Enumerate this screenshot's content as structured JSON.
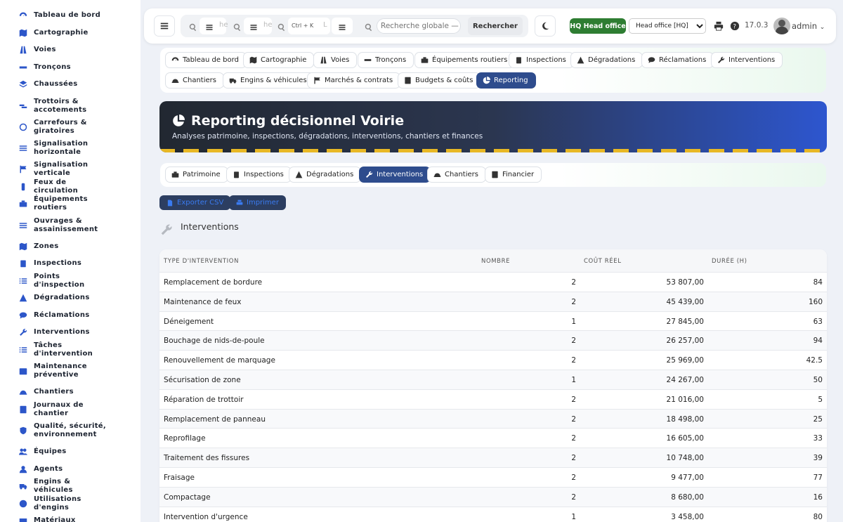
{
  "sidebar": {
    "items": [
      {
        "label": "Tableau de bord",
        "icon": "dashboard-icon"
      },
      {
        "label": "Cartographie",
        "icon": "map-icon"
      },
      {
        "label": "Voies",
        "icon": "road-icon"
      },
      {
        "label": "Tronçons",
        "icon": "segment-icon"
      },
      {
        "label": "Chaussées",
        "icon": "layers-icon"
      },
      {
        "label": "Trottoirs & accotements",
        "icon": "sidewalk-icon"
      },
      {
        "label": "Carrefours & giratoires",
        "icon": "roundabout-icon"
      },
      {
        "label": "Signalisation horizontale",
        "icon": "marking-icon"
      },
      {
        "label": "Signalisation verticale",
        "icon": "sign-icon"
      },
      {
        "label": "Feux de circulation",
        "icon": "traffic-light-icon"
      },
      {
        "label": "Équipements routiers",
        "icon": "equipment-icon"
      },
      {
        "label": "Ouvrages & assainissement",
        "icon": "water-icon"
      },
      {
        "label": "Zones",
        "icon": "zones-icon"
      },
      {
        "label": "Inspections",
        "icon": "clipboard-icon"
      },
      {
        "label": "Points d'inspection",
        "icon": "list-icon"
      },
      {
        "label": "Dégradations",
        "icon": "warning-icon"
      },
      {
        "label": "Réclamations",
        "icon": "comment-icon"
      },
      {
        "label": "Interventions",
        "icon": "wrench-icon"
      },
      {
        "label": "Tâches d'intervention",
        "icon": "tasks-icon"
      },
      {
        "label": "Maintenance préventive",
        "icon": "calendar-check-icon"
      },
      {
        "label": "Chantiers",
        "icon": "hardhat-icon"
      },
      {
        "label": "Journaux de chantier",
        "icon": "book-icon"
      },
      {
        "label": "Qualité, sécurité, environnement",
        "icon": "shield-icon"
      },
      {
        "label": "Équipes",
        "icon": "users-icon"
      },
      {
        "label": "Agents",
        "icon": "user-icon"
      },
      {
        "label": "Engins & véhicules",
        "icon": "truck-icon"
      },
      {
        "label": "Utilisations d'engins",
        "icon": "clock-icon"
      },
      {
        "label": "Matériaux",
        "icon": "box-icon"
      }
    ]
  },
  "topbar": {
    "search_placeholder": "Recherche globale — c",
    "search_button": "Rechercher",
    "mini_placeholder_1": "he",
    "mini_placeholder_2": "he",
    "mini_placeholder_3": "L",
    "shortcut": "Ctrl + K",
    "hq_badge": "HQ  Head office",
    "office_select": "Head office [HQ]",
    "version": "17.0.3",
    "username": "admin"
  },
  "nav": {
    "row1": [
      "Tableau de bord",
      "Cartographie",
      "Voies",
      "Tronçons",
      "Équipements routiers",
      "Inspections",
      "Dégradations",
      "Réclamations",
      "Interventions"
    ],
    "row2": [
      "Chantiers",
      "Engins & véhicules",
      "Marchés & contrats",
      "Budgets & coûts",
      "Reporting"
    ]
  },
  "banner": {
    "title": "Reporting décisionnel Voirie",
    "subtitle": "Analyses patrimoine, inspections, dégradations, interventions, chantiers et finances"
  },
  "subtabs": [
    "Patrimoine",
    "Inspections",
    "Dégradations",
    "Interventions",
    "Chantiers",
    "Financier"
  ],
  "actions": {
    "export": "Exporter CSV",
    "print": "Imprimer"
  },
  "section": {
    "title": "Interventions"
  },
  "table": {
    "headers": [
      "TYPE D'INTERVENTION",
      "NOMBRE",
      "COÛT RÉEL",
      "DURÉE (H)"
    ],
    "rows": [
      [
        "Remplacement de bordure",
        "2",
        "53 807,00",
        "84"
      ],
      [
        "Maintenance de feux",
        "2",
        "45 439,00",
        "160"
      ],
      [
        "Déneigement",
        "1",
        "27 845,00",
        "63"
      ],
      [
        "Bouchage de nids-de-poule",
        "2",
        "26 257,00",
        "94"
      ],
      [
        "Renouvellement de marquage",
        "2",
        "25 969,00",
        "42.5"
      ],
      [
        "Sécurisation de zone",
        "1",
        "24 267,00",
        "50"
      ],
      [
        "Réparation de trottoir",
        "2",
        "21 016,00",
        "5"
      ],
      [
        "Remplacement de panneau",
        "2",
        "18 498,00",
        "25"
      ],
      [
        "Reprofilage",
        "2",
        "16 605,00",
        "33"
      ],
      [
        "Traitement des fissures",
        "2",
        "10 748,00",
        "39"
      ],
      [
        "Fraisage",
        "2",
        "9 477,00",
        "77"
      ],
      [
        "Compactage",
        "2",
        "8 680,00",
        "16"
      ],
      [
        "Intervention d'urgence",
        "1",
        "3 458,00",
        "80"
      ]
    ]
  },
  "colors": {
    "accent": "#2d56cf",
    "active_pill": "#2e4c8d",
    "hq_green": "#2e7d32",
    "stripe": "#e8b825"
  }
}
